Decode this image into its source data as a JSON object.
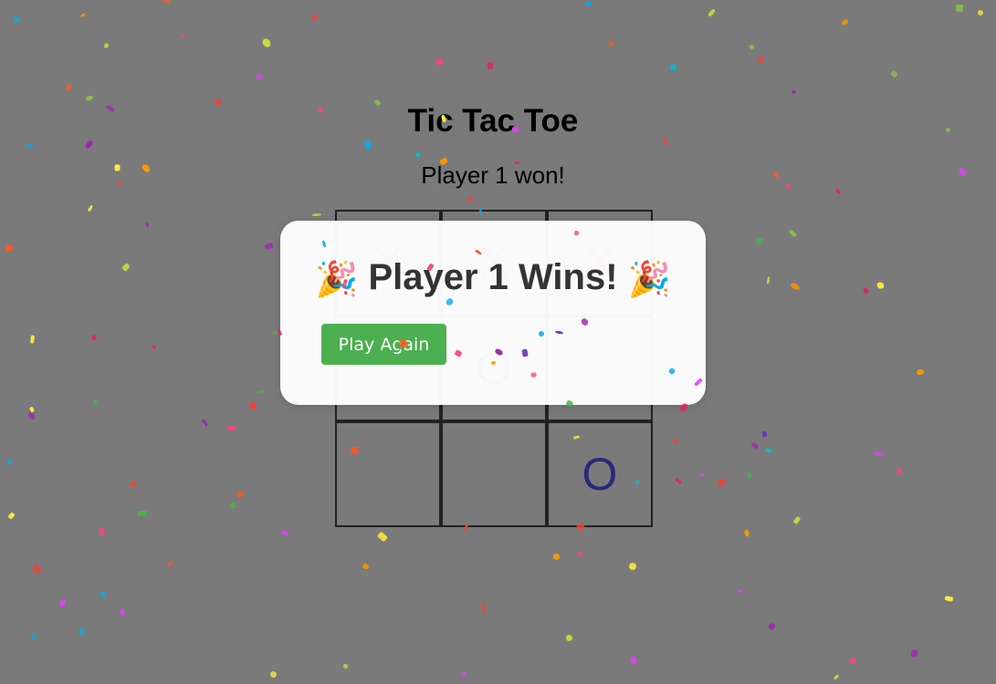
{
  "game": {
    "title": "Tic Tac Toe",
    "status": "Player 1 won!"
  },
  "board": {
    "cells": [
      "X",
      "X",
      "X",
      "",
      "O",
      "",
      "",
      "",
      "O"
    ]
  },
  "modal": {
    "party_icon": "🎉",
    "heading": "Player 1 Wins!",
    "play_again_label": "Play Again"
  },
  "colors": {
    "background": "#7a7a7a",
    "x_mark": "#8b1e1e",
    "o_mark": "#262a78",
    "button": "#4caf50",
    "confetti": [
      "#e91e63",
      "#9c27b0",
      "#673ab7",
      "#03a9f4",
      "#4caf50",
      "#8bc34a",
      "#ffeb3b",
      "#ff9800",
      "#ff5722",
      "#e040fb",
      "#00bcd4",
      "#cddc39",
      "#ff4081",
      "#f44336"
    ]
  }
}
